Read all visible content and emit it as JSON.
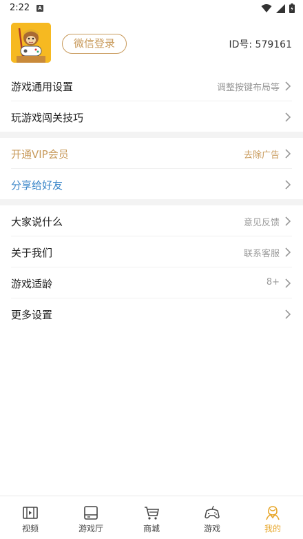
{
  "status_bar": {
    "time": "2:22",
    "notification_icon": "a-box-icon",
    "icons": [
      "wifi-icon",
      "signal-icon",
      "battery-icon"
    ]
  },
  "profile": {
    "avatar": "monkey-king-gamepad-avatar",
    "login_button": "微信登录",
    "user_id": "ID号: 579161"
  },
  "section1": [
    {
      "label": "游戏通用设置",
      "hint": "调整按键布局等"
    },
    {
      "label": "玩游戏闯关技巧",
      "hint": ""
    }
  ],
  "section2": [
    {
      "label": "开通VIP会员",
      "hint": "去除广告",
      "label_color": "#c89a5b",
      "hint_color": "#c89a5b"
    },
    {
      "label": "分享给好友",
      "hint": "",
      "label_color": "#3b86c8"
    }
  ],
  "section3": [
    {
      "label": "大家说什么",
      "hint": "意见反馈"
    },
    {
      "label": "关于我们",
      "hint": "联系客服"
    },
    {
      "label": "游戏适龄",
      "hint": "8+"
    },
    {
      "label": "更多设置",
      "hint": ""
    }
  ],
  "bottom_nav": [
    {
      "label": "视频",
      "icon": "film-icon",
      "active": false
    },
    {
      "label": "游戏厅",
      "icon": "arcade-icon",
      "active": false
    },
    {
      "label": "商城",
      "icon": "cart-icon",
      "active": false
    },
    {
      "label": "游戏",
      "icon": "gamepad-icon",
      "active": false
    },
    {
      "label": "我的",
      "icon": "user-icon",
      "active": true
    }
  ],
  "colors": {
    "accent_gold": "#c89a5b",
    "active_tab": "#e7a629",
    "share_blue": "#3b86c8",
    "divider": "#f3f3f3"
  }
}
